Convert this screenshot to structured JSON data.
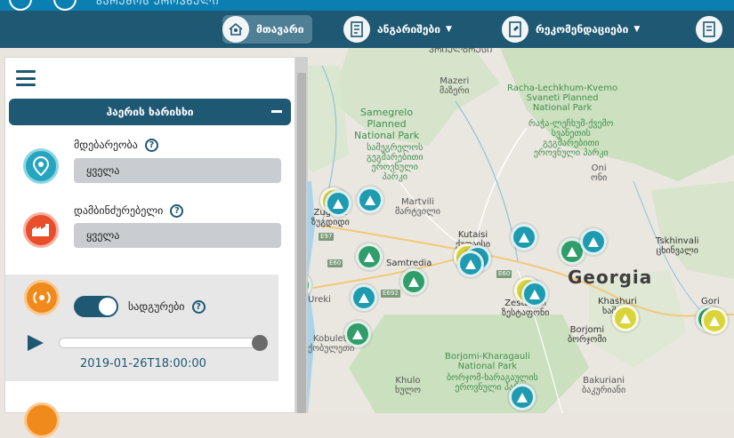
{
  "banner": {
    "title": "ᲒᲐᲠᲔᲛᲝᲡ ᲔᲠᲝᲕᲜᲣᲚᲘ"
  },
  "nav": {
    "items": [
      {
        "label": "მთავარი",
        "icon": "home-person-icon",
        "active": true
      },
      {
        "label": "ანგარიშები",
        "icon": "report-icon",
        "dropdown": true
      },
      {
        "label": "რეკომენდაციები",
        "icon": "recommendation-icon",
        "dropdown": true
      },
      {
        "label": "",
        "icon": "document-icon"
      }
    ]
  },
  "sidebar": {
    "section_title": "ჰაერის ხარისხი",
    "location": {
      "label": "მდებარეობა",
      "value": "ყველა",
      "icon": "location-pin-icon"
    },
    "polluter": {
      "label": "დამბინძურებელი",
      "value": "ყველა",
      "icon": "factory-icon"
    },
    "stations": {
      "label": "სადგურები",
      "enabled": true,
      "icon": "broadcast-icon"
    },
    "timeline": {
      "timestamp": "2019-01-26T18:00:00",
      "progress": 1.0
    }
  },
  "map": {
    "country": "Georgia",
    "labels": [
      {
        "text": "ᲞᲠᲘᲔᲚᲑᲠᲣᲡᲘ",
        "class": "lbl-gray"
      },
      {
        "text": "Mazeri\nმაზერი",
        "class": "lbl-gray"
      },
      {
        "text": "Racha-Lechkhum-Kvemo\nSvaneti Planned\nNational Park",
        "class": "lbl-green"
      },
      {
        "text": "რაჭა-ლეჩხუმ-ქვემო\nსვანეთის\nგეგმარებითი\nეროვნული პარკი",
        "class": "lbl-green"
      },
      {
        "text": "Samegrelo\nPlanned\nNational Park",
        "class": "lbl-green"
      },
      {
        "text": "სამეგრელოს\nგეგმარებითი\nეროვნული\nპარკი",
        "class": "lbl-green"
      },
      {
        "text": "Oni\nონი",
        "class": "lbl-gray"
      },
      {
        "text": "Martvili\nმარტვილი",
        "class": "lbl-gray"
      },
      {
        "text": "Kutaisi\nქუთაისი",
        "class": "lbl-city"
      },
      {
        "text": "Zugdidi\nზუგდიდი",
        "class": "lbl-city"
      },
      {
        "text": "Tskhinvali\nცხინვალი",
        "class": "lbl-city"
      },
      {
        "text": "Samtredia",
        "class": "lbl-city"
      },
      {
        "text": "Zestafoni\nზესტაფონი",
        "class": "lbl-city"
      },
      {
        "text": "Khashuri\nხაშური",
        "class": "lbl-city"
      },
      {
        "text": "Gori",
        "class": "lbl-city"
      },
      {
        "text": "Borjomi\nბორჯომი",
        "class": "lbl-city"
      },
      {
        "text": "Borjomi-Kharagauli\nNational Park",
        "class": "lbl-green"
      },
      {
        "text": "ბორჯომ-ხარაგაულის\nეროვნული პარკი",
        "class": "lbl-green"
      },
      {
        "text": "Bakuriani\nბაკურიანი",
        "class": "lbl-gray"
      },
      {
        "text": "Khulo\nხულო",
        "class": "lbl-gray"
      },
      {
        "text": "Ureki",
        "class": "lbl-gray"
      },
      {
        "text": "Kobuleti\nქობულეთი",
        "class": "lbl-gray"
      }
    ],
    "roads": [
      "E97",
      "E60",
      "E60",
      "E692"
    ]
  }
}
